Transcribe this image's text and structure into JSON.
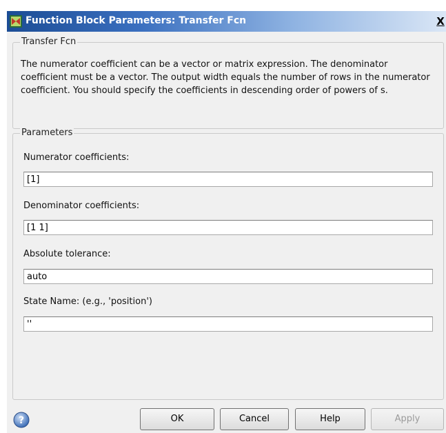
{
  "window": {
    "title": "Function Block Parameters: Transfer Fcn",
    "close_label": "X"
  },
  "block_group": {
    "legend": "Transfer Fcn",
    "description": "The numerator coefficient can be a vector or matrix expression. The denominator coefficient must be a vector. The output width equals the number of rows in the numerator coefficient. You should specify the coefficients in descending order of powers of s."
  },
  "parameters": {
    "legend": "Parameters",
    "numerator": {
      "label": "Numerator coefficients:",
      "value": "[1]"
    },
    "denominator": {
      "label": "Denominator coefficients:",
      "value": "[1 1]"
    },
    "abs_tol": {
      "label": "Absolute tolerance:",
      "value": "auto"
    },
    "state_name": {
      "label": "State Name: (e.g., 'position')",
      "value": "''"
    }
  },
  "buttons": {
    "ok": "OK",
    "cancel": "Cancel",
    "help": "Help",
    "apply": "Apply"
  },
  "icons": {
    "app": "simulink-block-icon",
    "help": "help-question-icon"
  }
}
